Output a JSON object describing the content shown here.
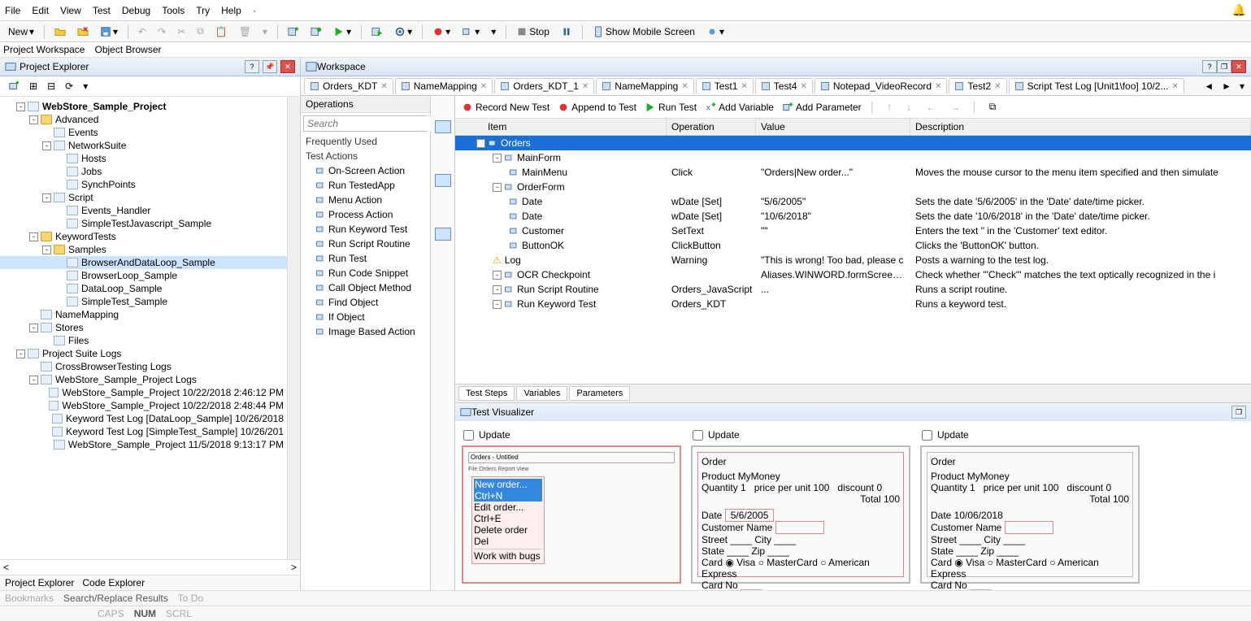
{
  "menu": [
    "File",
    "Edit",
    "View",
    "Test",
    "Debug",
    "Tools",
    "Try",
    "Help"
  ],
  "toolbar": {
    "new": "New",
    "stop": "Stop",
    "show_mobile": "Show Mobile Screen"
  },
  "workspace_tabs": {
    "project_workspace": "Project Workspace",
    "object_browser": "Object Browser"
  },
  "project_explorer": {
    "title": "Project Explorer",
    "tree": [
      {
        "d": 1,
        "t": "-",
        "ico": "proj",
        "label": "WebStore_Sample_Project",
        "bold": true
      },
      {
        "d": 2,
        "t": "-",
        "ico": "folder",
        "label": "Advanced"
      },
      {
        "d": 3,
        "t": "",
        "ico": "file",
        "label": "Events"
      },
      {
        "d": 3,
        "t": "-",
        "ico": "net",
        "label": "NetworkSuite"
      },
      {
        "d": 4,
        "t": "",
        "ico": "file",
        "label": "Hosts"
      },
      {
        "d": 4,
        "t": "",
        "ico": "file",
        "label": "Jobs"
      },
      {
        "d": 4,
        "t": "",
        "ico": "file",
        "label": "SynchPoints"
      },
      {
        "d": 3,
        "t": "-",
        "ico": "script",
        "label": "Script"
      },
      {
        "d": 4,
        "t": "",
        "ico": "file",
        "label": "Events_Handler"
      },
      {
        "d": 4,
        "t": "",
        "ico": "file",
        "label": "SimpleTestJavascript_Sample"
      },
      {
        "d": 2,
        "t": "-",
        "ico": "folder",
        "label": "KeywordTests"
      },
      {
        "d": 3,
        "t": "-",
        "ico": "folder",
        "label": "Samples"
      },
      {
        "d": 4,
        "t": "",
        "ico": "file",
        "label": "BrowserAndDataLoop_Sample",
        "sel": true
      },
      {
        "d": 4,
        "t": "",
        "ico": "file",
        "label": "BrowserLoop_Sample"
      },
      {
        "d": 4,
        "t": "",
        "ico": "file",
        "label": "DataLoop_Sample"
      },
      {
        "d": 4,
        "t": "",
        "ico": "file",
        "label": "SimpleTest_Sample"
      },
      {
        "d": 2,
        "t": "",
        "ico": "map",
        "label": "NameMapping"
      },
      {
        "d": 2,
        "t": "-",
        "ico": "store",
        "label": "Stores"
      },
      {
        "d": 3,
        "t": "",
        "ico": "file",
        "label": "Files"
      },
      {
        "d": 1,
        "t": "-",
        "ico": "logs",
        "label": "Project Suite Logs"
      },
      {
        "d": 2,
        "t": "",
        "ico": "file",
        "label": "CrossBrowserTesting Logs"
      },
      {
        "d": 2,
        "t": "-",
        "ico": "logs",
        "label": "WebStore_Sample_Project Logs"
      },
      {
        "d": 3,
        "t": "",
        "ico": "log",
        "label": "WebStore_Sample_Project 10/22/2018 2:46:12 PM"
      },
      {
        "d": 3,
        "t": "",
        "ico": "log",
        "label": "WebStore_Sample_Project 10/22/2018 2:48:44 PM"
      },
      {
        "d": 3,
        "t": "",
        "ico": "log",
        "label": "Keyword Test Log [DataLoop_Sample] 10/26/2018"
      },
      {
        "d": 3,
        "t": "",
        "ico": "log",
        "label": "Keyword Test Log [SimpleTest_Sample] 10/26/201"
      },
      {
        "d": 3,
        "t": "",
        "ico": "log",
        "label": "WebStore_Sample_Project 11/5/2018 9:13:17 PM"
      }
    ],
    "bottom_tabs": {
      "pe": "Project Explorer",
      "ce": "Code Explorer"
    }
  },
  "workspace": {
    "title": "Workspace",
    "doc_tabs": [
      "Orders_KDT",
      "NameMapping",
      "Orders_KDT_1",
      "NameMapping",
      "Test1",
      "Test4",
      "Notepad_VideoRecord",
      "Test2",
      "Script Test Log [Unit1\\foo] 10/2..."
    ],
    "ops_panel": {
      "title": "Operations",
      "search_placeholder": "Search",
      "categories": [
        "Frequently Used",
        "Test Actions"
      ],
      "items": [
        "On-Screen Action",
        "Run TestedApp",
        "Menu Action",
        "Process Action",
        "Run Keyword Test",
        "Run Script Routine",
        "Run Test",
        "Run Code Snippet",
        "Call Object Method",
        "Find Object",
        "If Object",
        "Image Based Action"
      ]
    },
    "action_bar": {
      "record": "Record New Test",
      "append": "Append to Test",
      "run": "Run Test",
      "addvar": "Add Variable",
      "addparam": "Add Parameter"
    },
    "grid": {
      "headers": {
        "item": "Item",
        "op": "Operation",
        "val": "Value",
        "desc": "Description"
      },
      "rows": [
        {
          "d": 0,
          "item": "Orders",
          "sel": true
        },
        {
          "d": 1,
          "item": "MainForm"
        },
        {
          "d": 2,
          "item": "MainMenu",
          "op": "Click",
          "val": "\"Orders|New order...\"",
          "desc": "Moves the mouse cursor to the menu item specified and then simulate"
        },
        {
          "d": 1,
          "item": "OrderForm"
        },
        {
          "d": 2,
          "item": "Date",
          "op": "wDate [Set]",
          "val": "\"5/6/2005\"",
          "desc": "Sets the date '5/6/2005' in the 'Date' date/time picker."
        },
        {
          "d": 2,
          "item": "Date",
          "op": "wDate [Set]",
          "val": "\"10/6/2018\"",
          "desc": "Sets the date '10/6/2018' in the 'Date' date/time picker."
        },
        {
          "d": 2,
          "item": "Customer",
          "op": "SetText",
          "val": "\"\"",
          "desc": "Enters the text \" in the 'Customer' text editor."
        },
        {
          "d": 2,
          "item": "ButtonOK",
          "op": "ClickButton",
          "val": "",
          "desc": "Clicks the 'ButtonOK' button."
        },
        {
          "d": 1,
          "item": "Log",
          "op": "Warning",
          "val": "\"This is wrong! Too bad, please c",
          "desc": "Posts a warning to the test log.",
          "warn": true
        },
        {
          "d": 1,
          "item": "OCR Checkpoint",
          "op": "",
          "val": "Aliases.WINWORD.formScreensh",
          "desc": "Check whether '\"Check\"' matches the text optically recognized in the i"
        },
        {
          "d": 1,
          "item": "Run Script Routine",
          "op": "Orders_JavaScript",
          "val": "...",
          "desc": "Runs a script routine."
        },
        {
          "d": 1,
          "item": "Run Keyword Test",
          "op": "Orders_KDT",
          "val": "",
          "desc": "Runs a keyword test."
        }
      ]
    },
    "bottom_tabs": [
      "Test Steps",
      "Variables",
      "Parameters"
    ]
  },
  "visualizer": {
    "title": "Test Visualizer",
    "update": "Update"
  },
  "status": {
    "left": [
      "Bookmarks",
      "Search/Replace Results",
      "To Do"
    ],
    "right": [
      "CAPS",
      "NUM",
      "SCRL"
    ]
  }
}
